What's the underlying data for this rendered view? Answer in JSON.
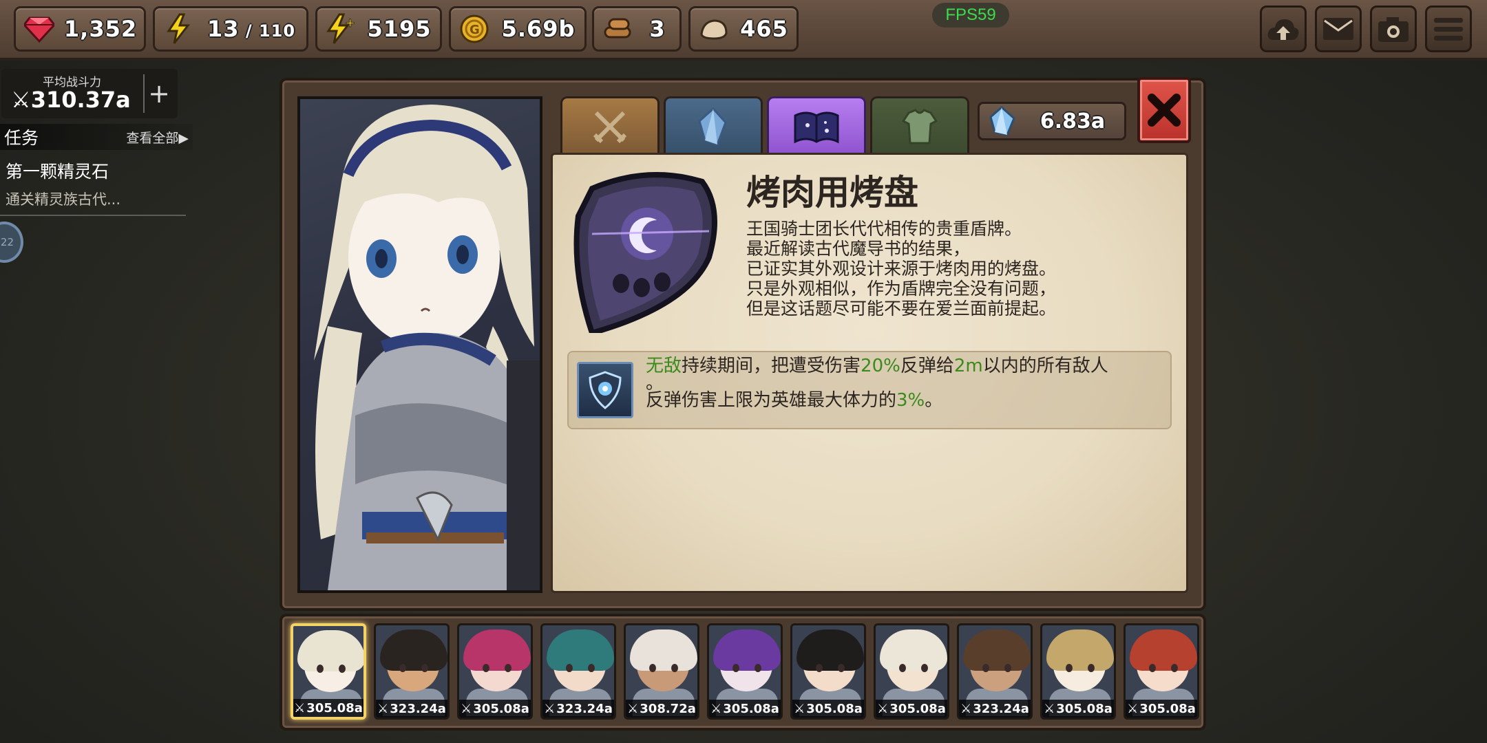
{
  "resources": {
    "gems": "1,352",
    "energy_current": "13",
    "energy_sep": " / ",
    "energy_max": "110",
    "boost": "5195",
    "gold": "5.69b",
    "wood": "3",
    "stone": "465"
  },
  "fps": "FPS59",
  "top_buttons": [
    "cloud-upload-icon",
    "mail-icon",
    "camera-icon",
    "menu-icon"
  ],
  "power": {
    "label": "平均战斗力",
    "value": "310.37a",
    "plus": "+"
  },
  "quests": {
    "title": "任务",
    "view_all": "查看全部▶",
    "item_title": "第一颗精灵石",
    "item_desc": "通关精灵族古代...",
    "orb_label": "22"
  },
  "crystals": "6.83a",
  "item": {
    "name": "烤肉用烤盘",
    "description": [
      "王国骑士团长代代相传的贵重盾牌。",
      "最近解读古代魔导书的结果，",
      "已证实其外观设计来源于烤肉用的烤盘。",
      "只是外观相似，作为盾牌完全没有问题，",
      "但是这话题尽可能不要在爱兰面前提起。"
    ]
  },
  "skill": {
    "kw_invincible": "无敌",
    "t1": "持续期间，把遭受伤害",
    "kw_pct": "20%",
    "t2": "反弹给",
    "kw_range": "2m",
    "t3": "以内的所有敌人",
    "t4": "。",
    "t5": "反弹伤害上限为英雄最大体力的",
    "kw_cap": "3%",
    "t6": "。"
  },
  "tabs": [
    "crossed-swords-icon",
    "crystal-icon",
    "spellbook-icon",
    "armor-icon"
  ],
  "colors": {
    "accent_green": "#3c8a1e",
    "close_red": "#d64038",
    "selected_tab": "#a66be0",
    "selected_hero_border": "#f4d26a"
  },
  "heroes": [
    {
      "power": "305.08a",
      "hair": "#e9e3d2",
      "skin": "#f7efe6",
      "selected": true
    },
    {
      "power": "323.24a",
      "hair": "#2a2420",
      "skin": "#d9a77c"
    },
    {
      "power": "305.08a",
      "hair": "#b8356a",
      "skin": "#f3d9cf"
    },
    {
      "power": "323.24a",
      "hair": "#2f7a7a",
      "skin": "#f2dbc8"
    },
    {
      "power": "308.72a",
      "hair": "#e8e2da",
      "skin": "#c99a78"
    },
    {
      "power": "305.08a",
      "hair": "#6b3aa0",
      "skin": "#f0e4ea"
    },
    {
      "power": "305.08a",
      "hair": "#1f1c1c",
      "skin": "#f4dccb"
    },
    {
      "power": "305.08a",
      "hair": "#ece6d8",
      "skin": "#f4e2d0"
    },
    {
      "power": "323.24a",
      "hair": "#5a3e2c",
      "skin": "#caa07e"
    },
    {
      "power": "305.08a",
      "hair": "#c4a76a",
      "skin": "#f6ecdf"
    },
    {
      "power": "305.08a",
      "hair": "#b7412f",
      "skin": "#f5dccb"
    }
  ]
}
